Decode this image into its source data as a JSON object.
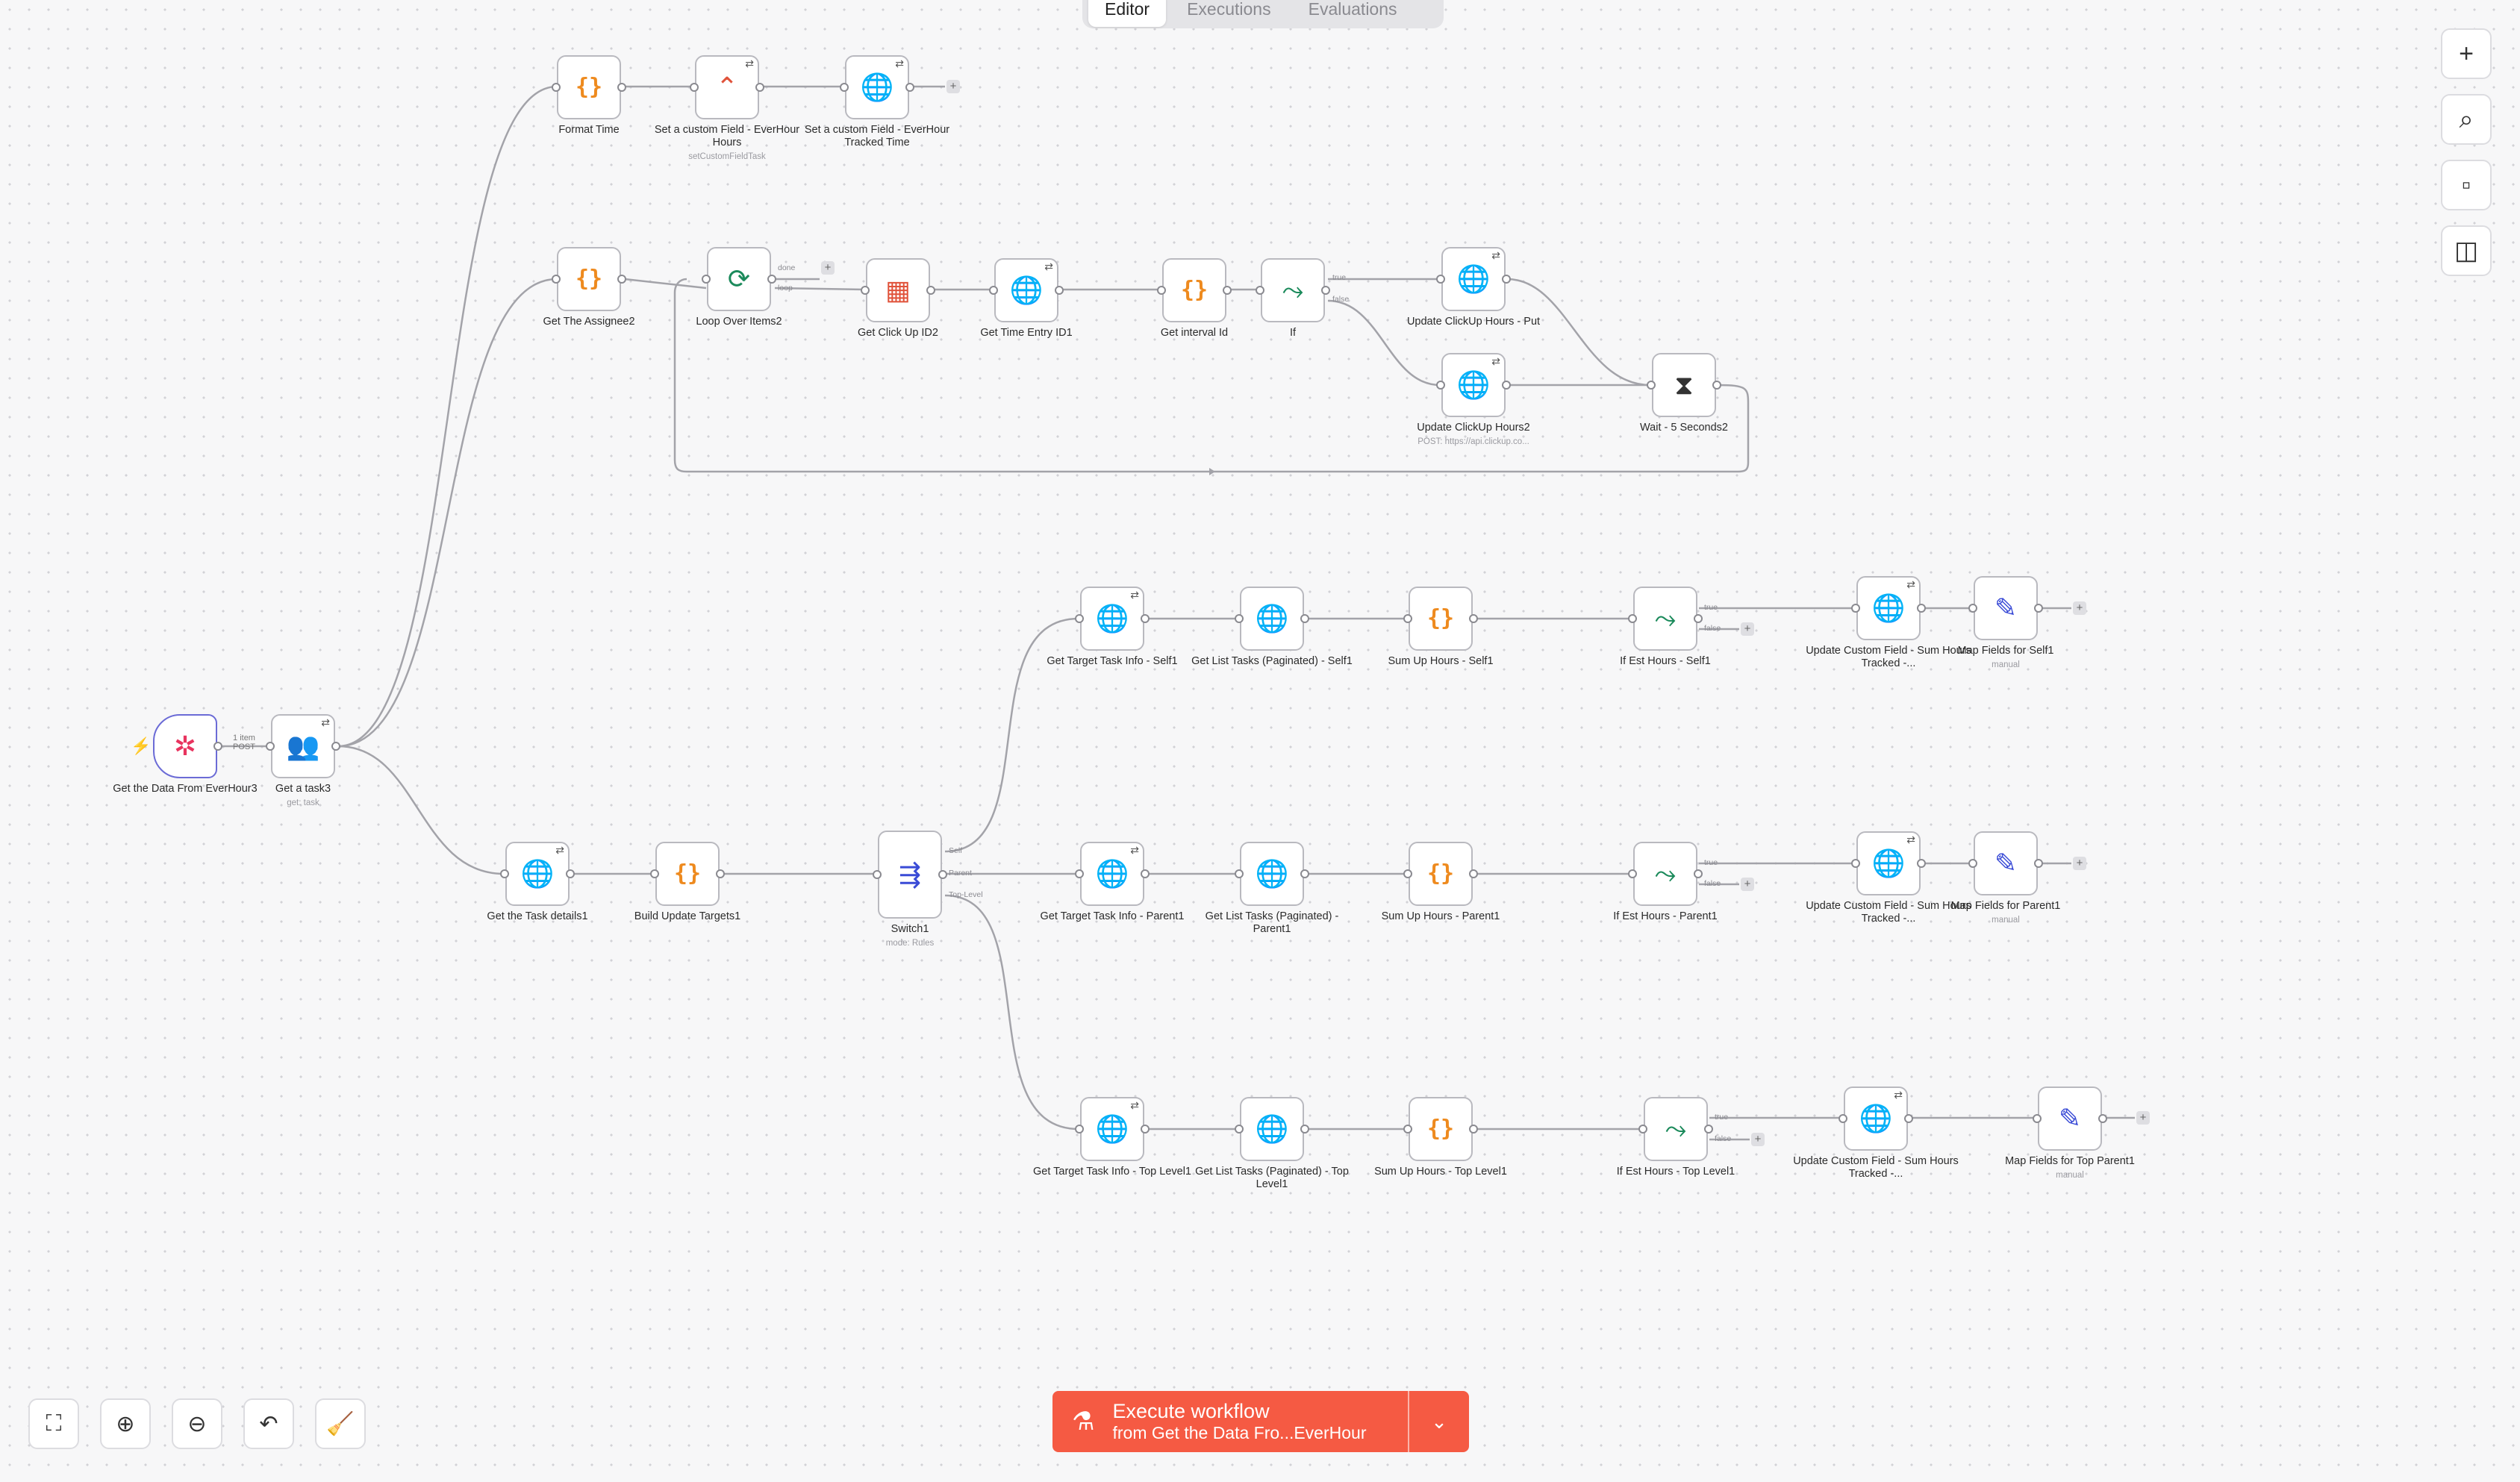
{
  "tabs": {
    "editor": "Editor",
    "executions": "Executions",
    "evaluations": "Evaluations"
  },
  "nodes": {
    "trigger": {
      "label": "Get the Data From EverHour3"
    },
    "get_task": {
      "label": "Get a task3",
      "sub": "get: task"
    },
    "format_time": {
      "label": "Format Time"
    },
    "set_cf_hours": {
      "label": "Set a custom Field - EverHour Hours",
      "sub": "setCustomFieldTask"
    },
    "set_cf_tracked": {
      "label": "Set a custom Field - EverHour Tracked Time"
    },
    "get_assignee": {
      "label": "Get The Assignee2"
    },
    "loop": {
      "label": "Loop Over Items2"
    },
    "get_clickup_id": {
      "label": "Get Click Up ID2"
    },
    "get_time_entry": {
      "label": "Get Time Entry ID1"
    },
    "get_interval": {
      "label": "Get interval Id"
    },
    "if_node": {
      "label": "If"
    },
    "update_put": {
      "label": "Update ClickUp Hours - Put"
    },
    "update_post": {
      "label": "Update ClickUp Hours2",
      "sub": "POST: https://api.clickup.co..."
    },
    "wait": {
      "label": "Wait - 5 Seconds2"
    },
    "task_details": {
      "label": "Get the Task details1"
    },
    "build_targets": {
      "label": "Build Update Targets1"
    },
    "switch": {
      "label": "Switch1",
      "sub": "mode: Rules"
    },
    "target_self": {
      "label": "Get Target Task Info - Self1"
    },
    "list_self": {
      "label": "Get List Tasks (Paginated) - Self1"
    },
    "sum_self": {
      "label": "Sum Up Hours - Self1"
    },
    "if_self": {
      "label": "If Est Hours - Self1"
    },
    "update_self": {
      "label": "Update Custom Field - Sum Hours Tracked -..."
    },
    "map_self": {
      "label": "Map Fields for Self1",
      "sub": "manual"
    },
    "target_parent": {
      "label": "Get Target Task Info - Parent1"
    },
    "list_parent": {
      "label": "Get List Tasks (Paginated) - Parent1"
    },
    "sum_parent": {
      "label": "Sum Up Hours - Parent1"
    },
    "if_parent": {
      "label": "If Est Hours - Parent1"
    },
    "update_parent": {
      "label": "Update Custom Field - Sum Hours Tracked -..."
    },
    "map_parent": {
      "label": "Map Fields for Parent1",
      "sub": "manual"
    },
    "target_top": {
      "label": "Get Target Task Info - Top Level1"
    },
    "list_top": {
      "label": "Get List Tasks (Paginated) - Top Level1"
    },
    "sum_top": {
      "label": "Sum Up Hours - Top Level1"
    },
    "if_top": {
      "label": "If Est Hours - Top Level1"
    },
    "update_top": {
      "label": "Update Custom Field - Sum Hours Tracked -..."
    },
    "map_top": {
      "label": "Map Fields for Top Parent1",
      "sub": "manual"
    }
  },
  "edge_labels": {
    "items": "1 item",
    "method": "POST"
  },
  "port_labels": {
    "done": "done",
    "loop": "loop",
    "true": "true",
    "false": "false",
    "self": "Self",
    "parent": "Parent",
    "top_level": "Top-Level"
  },
  "execute": {
    "title": "Execute workflow",
    "subtitle": "from Get the Data Fro...EverHour"
  },
  "icons": {
    "right_toolbar": [
      "plus-icon",
      "search-icon",
      "sticky-note-icon",
      "panel-icon"
    ],
    "bottom_toolbar": [
      "fit-view-icon",
      "zoom-in-icon",
      "zoom-out-icon",
      "undo-icon",
      "clean-up-icon"
    ]
  },
  "colors": {
    "execute_button": "#f55a43",
    "code_node": "#ee8a1e",
    "http_node": "#3a3fb5",
    "if_node": "#1b8a5b"
  }
}
